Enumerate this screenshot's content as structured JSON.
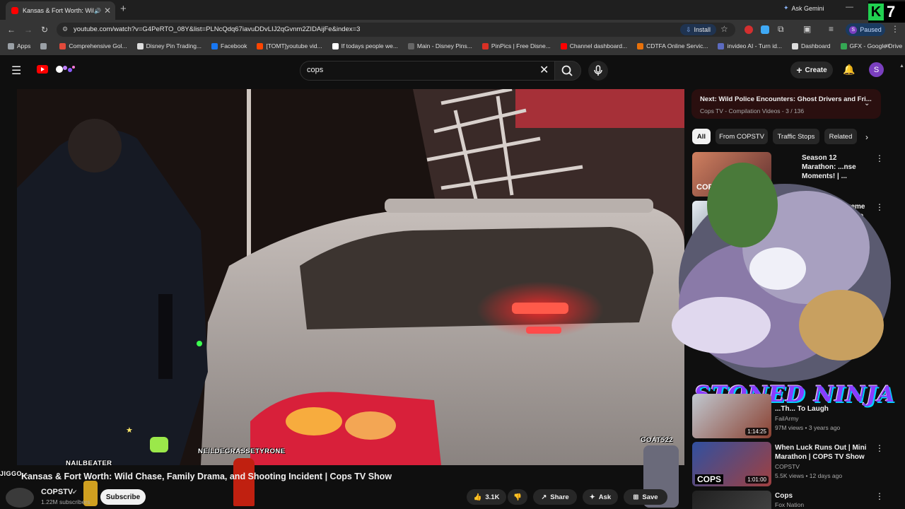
{
  "browser": {
    "tab_title": "Kansas & Fort Worth: Wild",
    "new_tab_symbol": "+",
    "tab_close_symbol": "✕",
    "ask_gemini": "Ask Gemini",
    "url": "youtube.com/watch?v=G4PeRTO_08Y&list=PLNcQdq67iavuDDvLIJ2qGvnm2ZIDAijFe&index=3",
    "install_label": "Install",
    "paused_label": "Paused",
    "paused_avatar": "S",
    "bookmarks": [
      {
        "label": "Apps",
        "color": "#9aa0a6"
      },
      {
        "label": "",
        "color": "#9aa0a6"
      },
      {
        "label": "Comprehensive Gol...",
        "color": "#e24a3b"
      },
      {
        "label": "Disney Pin Trading...",
        "color": "#dddddd"
      },
      {
        "label": "Facebook",
        "color": "#1877f2"
      },
      {
        "label": "[TOMT]youtube vid...",
        "color": "#ff4500"
      },
      {
        "label": "If todays people we...",
        "color": "#ffffff"
      },
      {
        "label": "Main - Disney Pins...",
        "color": "#666666"
      },
      {
        "label": "PinPics | Free Disne...",
        "color": "#d93025"
      },
      {
        "label": "Channel dashboard...",
        "color": "#ff0000"
      },
      {
        "label": "CDTFA Online Servic...",
        "color": "#e8710a"
      },
      {
        "label": "invideo AI - Turn id...",
        "color": "#5c6bc0"
      },
      {
        "label": "Dashboard",
        "color": "#dddddd"
      },
      {
        "label": "GFX - Google Drive",
        "color": "#34a853"
      }
    ],
    "bookmarks_more": "»"
  },
  "youtube": {
    "search_value": "cops",
    "create_label": "Create",
    "avatar_letter": "S",
    "video_title": "Kansas & Fort Worth: Wild Chase, Family Drama, and Shooting Incident | Cops TV Show",
    "channel_name": "COPSTV",
    "subscribers": "1.22M subscribers",
    "subscribe_label": "Subscribe",
    "like_count": "3.1K",
    "share_label": "Share",
    "ask_label": "Ask",
    "save_label": "Save",
    "playlist": {
      "next_label": "Next: Wild Police Encounters: Ghost Drivers and Fri...",
      "sub_label": "Cops TV - Compilation Videos - 3 / 136"
    },
    "chips": [
      "All",
      "From COPSTV",
      "Traffic Stops",
      "Related"
    ],
    "recommendations": [
      {
        "title": "Season 12 Marathon: ...nse Moments! | ...",
        "meta": "",
        "duration": "",
        "thumb_label": "COPS SEASON 12"
      },
      {
        "title": "Extreme ...llenge",
        "meta": "",
        "duration": "",
        "thumb_label": ""
      },
      {
        "title": "...Th... To Laugh",
        "channel": "FailArmy",
        "meta": "97M views • 3 years ago",
        "duration": "1:14:25"
      },
      {
        "title": "When Luck Runs Out | Mini Marathon | COPS TV Show",
        "channel": "COPSTV",
        "meta": "5.5K views • 12 days ago",
        "duration": "1:01:00",
        "thumb_label": "COPS"
      },
      {
        "title": "Cops",
        "channel": "Fox Nation",
        "meta": "",
        "duration": ""
      }
    ]
  },
  "overlays": {
    "left_tag": "JIGGO...",
    "nailbeater": "NAILBEATER",
    "neil": "NEILDEGRASSETYRONE",
    "goat": "GOAT522",
    "stoned_ninja": "STONED NINJA"
  },
  "colors": {
    "youtube_red": "#ff0000",
    "background": "#0f0f0f",
    "ninja_purple": "#8a3cff"
  }
}
